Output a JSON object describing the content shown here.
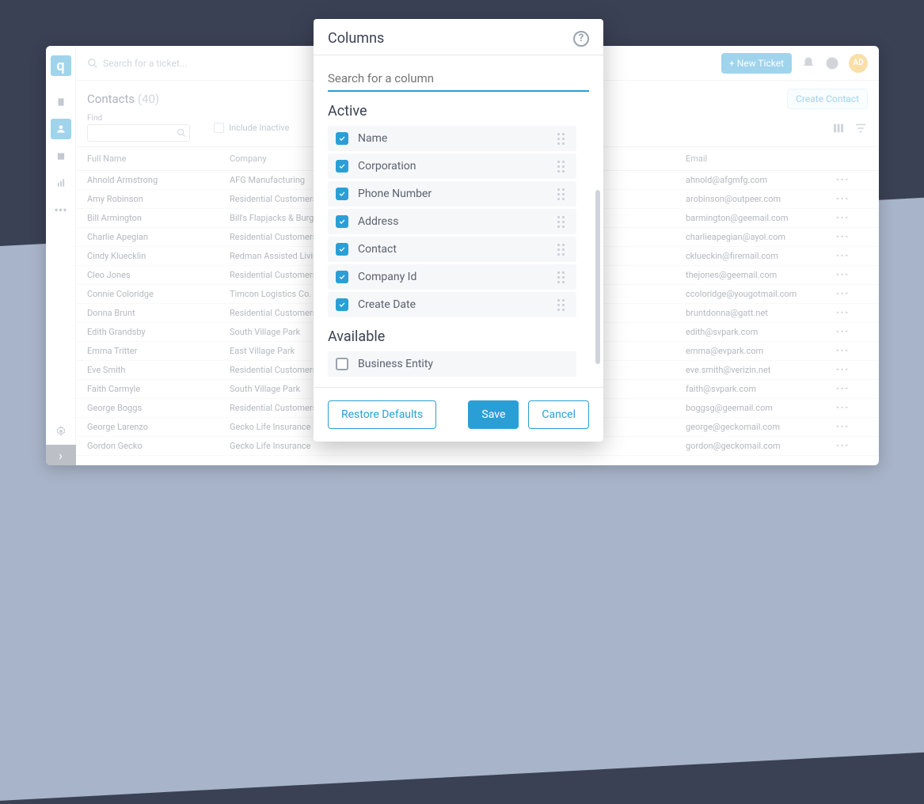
{
  "topbar": {
    "search_placeholder": "Search for a ticket...",
    "new_ticket": "New Ticket",
    "avatar": "AD"
  },
  "page": {
    "title": "Contacts",
    "count": "(40)",
    "create_label": "Create Contact",
    "find_label": "Find",
    "include_inactive": "Include Inactive"
  },
  "columns": {
    "name": "Full Name",
    "company": "Company",
    "email": "Email"
  },
  "rows": [
    {
      "name": "Ahnold Armstrong",
      "company": "AFG Manufacturing",
      "email": "ahnold@afgmfg.com"
    },
    {
      "name": "Amy Robinson",
      "company": "Residential Customers",
      "email": "arobinson@outpeer.com"
    },
    {
      "name": "Bill Armington",
      "company": "Bill's Flapjacks & Burgers",
      "email": "barmington@geemail.com"
    },
    {
      "name": "Charlie Apegian",
      "company": "Residential Customers",
      "email": "charlieapegian@ayol.com"
    },
    {
      "name": "Cindy Kluecklin",
      "company": "Redman Assisted Living",
      "email": "cklueckin@firemail.com"
    },
    {
      "name": "Cleo Jones",
      "company": "Residential Customers",
      "email": "thejones@geemail.com"
    },
    {
      "name": "Connie Coloridge",
      "company": "Timcon Logistics Co.",
      "email": "ccoloridge@yougotmail.com"
    },
    {
      "name": "Donna Brunt",
      "company": "Residential Customers",
      "email": "bruntdonna@gatt.net"
    },
    {
      "name": "Edith Grandsby",
      "company": "South Village Park",
      "email": "edith@svpark.com"
    },
    {
      "name": "Emma Tritter",
      "company": "East Village Park",
      "email": "emma@evpark.com"
    },
    {
      "name": "Eve Smith",
      "company": "Residential Customers",
      "email": "eve.smith@verizin.net"
    },
    {
      "name": "Faith Carmyle",
      "company": "South Village Park",
      "email": "faith@svpark.com"
    },
    {
      "name": "George Boggs",
      "company": "Residential Customers",
      "email": "boggsg@geemail.com"
    },
    {
      "name": "George Larenzo",
      "company": "Gecko Life Insurance",
      "email": "george@geckomail.com"
    },
    {
      "name": "Gordon Gecko",
      "company": "Gecko Life Insurance",
      "email": "gordon@geckomail.com"
    }
  ],
  "modal": {
    "title": "Columns",
    "search_placeholder": "Search for a column",
    "active_label": "Active",
    "available_label": "Available",
    "active": [
      {
        "label": "Name"
      },
      {
        "label": "Corporation"
      },
      {
        "label": "Phone Number"
      },
      {
        "label": "Address"
      },
      {
        "label": "Contact"
      },
      {
        "label": "Company Id"
      },
      {
        "label": "Create Date"
      }
    ],
    "available": [
      {
        "label": "Business Entity"
      }
    ],
    "restore": "Restore Defaults",
    "save": "Save",
    "cancel": "Cancel"
  }
}
